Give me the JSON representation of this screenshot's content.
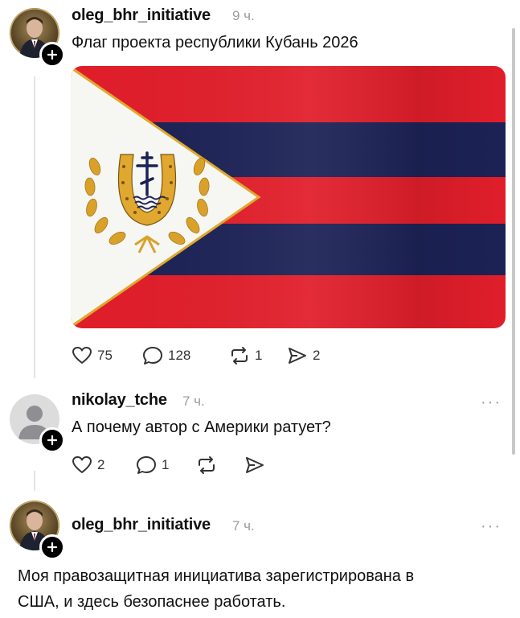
{
  "post1": {
    "username": "oleg_bhr_initiative",
    "time": "9 ч.",
    "text": "Флаг проекта республики Кубань 2026",
    "actions": {
      "likes": "75",
      "comments": "128",
      "reposts": "1",
      "shares": "2"
    },
    "flag": {
      "red": "#e01e2a",
      "blue": "#1c2255",
      "white": "#f6f6f3",
      "gold": "#e0a82e"
    }
  },
  "post2": {
    "username": "nikolay_tche",
    "time": "7 ч.",
    "text": "А почему автор с Америки ратует?",
    "actions": {
      "likes": "2",
      "comments": "1"
    },
    "more": "···"
  },
  "post3": {
    "username": "oleg_bhr_initiative",
    "time": "7 ч.",
    "text_line1": "Моя правозащитная инициатива зарегистрирована в",
    "text_line2": "США, и здесь безопаснее работать.",
    "more": "···"
  }
}
